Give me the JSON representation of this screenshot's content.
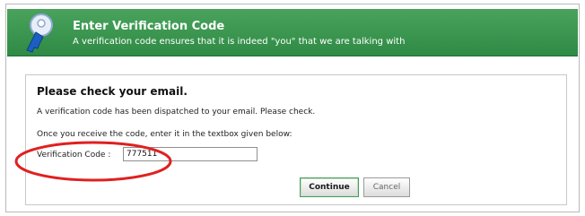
{
  "header": {
    "title": "Enter Verification Code",
    "subtitle": "A verification code ensures that it is indeed \"you\" that we are talking with",
    "icon": "key-icon",
    "background_color": "#3a9650"
  },
  "content": {
    "heading": "Please check your email.",
    "message_line1": "A verification code has been dispatched to your email. Please check.",
    "message_line2": "Once you receive the code, enter it in the textbox given below:",
    "field_label": "Verification Code :",
    "field_value": "777511",
    "highlight_color": "#e02020"
  },
  "buttons": {
    "continue_label": "Continue",
    "cancel_label": "Cancel"
  }
}
